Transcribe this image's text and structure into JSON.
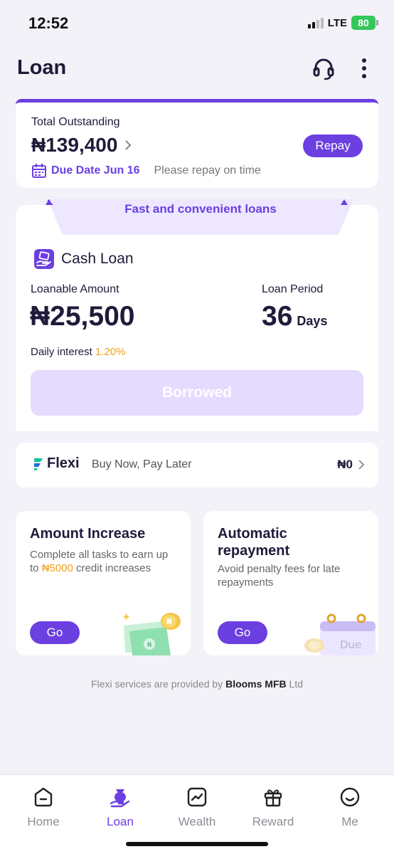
{
  "status_bar": {
    "time": "12:52",
    "network": "LTE",
    "battery": "80"
  },
  "header": {
    "title": "Loan"
  },
  "outstanding": {
    "label": "Total Outstanding",
    "amount": "₦139,400",
    "repay_label": "Repay",
    "due_date": "Due Date Jun 16",
    "hint": "Please repay on time"
  },
  "cash_loan": {
    "banner": "Fast and convenient loans",
    "title": "Cash Loan",
    "loanable_label": "Loanable Amount",
    "loanable_amount": "₦25,500",
    "period_label": "Loan Period",
    "period_value": "36",
    "period_unit": "Days",
    "interest_label": "Daily interest",
    "interest_rate": "1.20%",
    "button_label": "Borrowed"
  },
  "flexi": {
    "brand": "Flexi",
    "tagline": "Buy Now, Pay Later",
    "balance": "₦0"
  },
  "promos": [
    {
      "title": "Amount Increase",
      "desc_before": "Complete all tasks to earn up to ",
      "desc_highlight": "₦5000",
      "desc_after": " credit increases",
      "button": "Go"
    },
    {
      "title": "Automatic repayment",
      "desc": "Avoid penalty fees for late repayments",
      "button": "Go",
      "art_label": "Due"
    }
  ],
  "footer": {
    "prefix": "Flexi services are provided by ",
    "bank": "Blooms MFB",
    "suffix": " Ltd"
  },
  "tabs": [
    {
      "label": "Home",
      "active": false
    },
    {
      "label": "Loan",
      "active": true
    },
    {
      "label": "Wealth",
      "active": false
    },
    {
      "label": "Reward",
      "active": false
    },
    {
      "label": "Me",
      "active": false
    }
  ],
  "colors": {
    "accent": "#6b3fe0",
    "highlight": "#f0a020",
    "background": "#f3f2f8"
  },
  "icons": [
    "headset-icon",
    "more-icon",
    "calendar-icon",
    "chevron-right-icon",
    "cash-loan-icon",
    "flexi-logo-icon",
    "home-icon",
    "loan-icon",
    "wealth-icon",
    "reward-icon",
    "me-icon"
  ]
}
